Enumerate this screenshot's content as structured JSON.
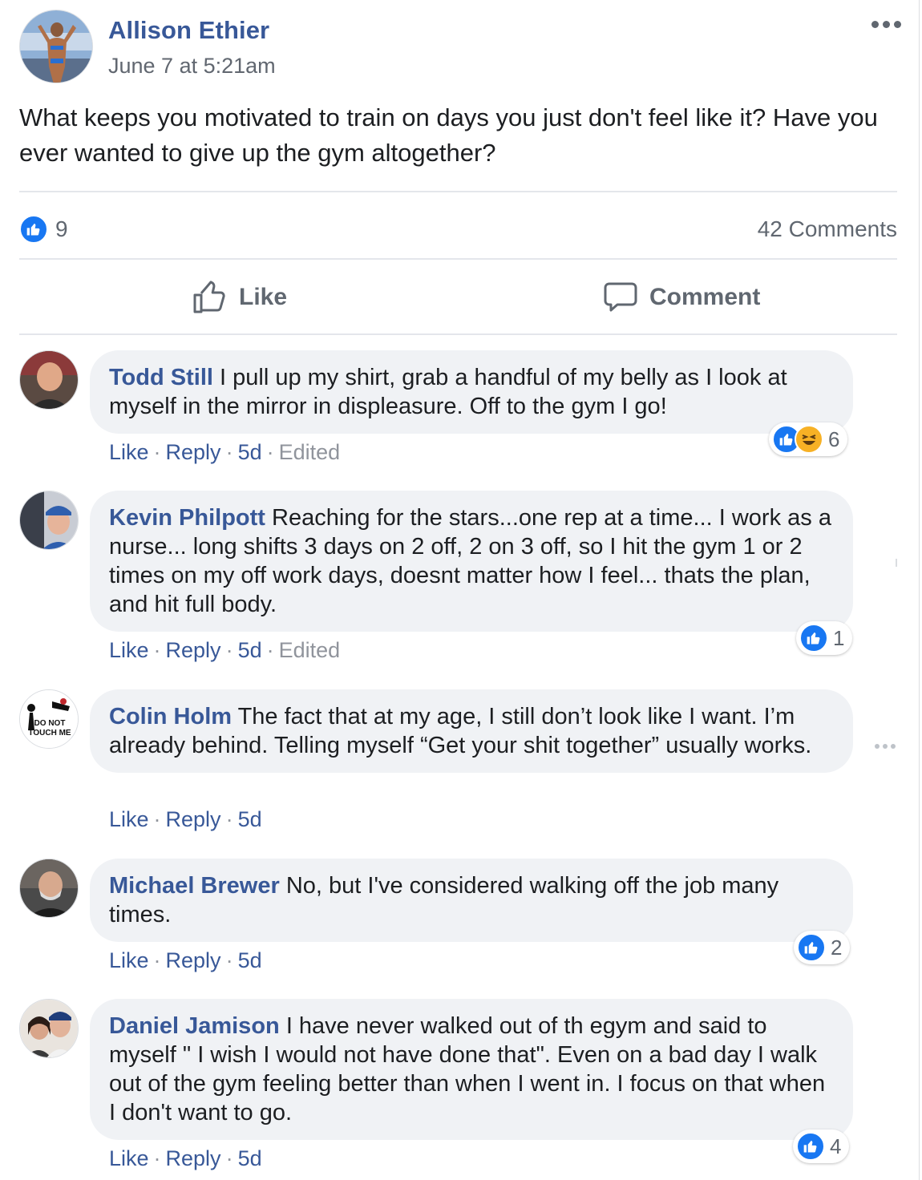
{
  "post": {
    "author": "Allison Ethier",
    "timestamp": "June 7 at 5:21am",
    "text": "What keeps you motivated to train on days you just don't feel like it? Have you ever wanted to give up the gym altogether?",
    "like_count": "9",
    "comments_count": "42 Comments",
    "actions": {
      "like": "Like",
      "comment": "Comment"
    }
  },
  "comments": [
    {
      "name": "Todd Still",
      "text": "I pull up my shirt, grab a handful of my belly as I look at myself in the mirror in displeasure. Off to the gym I go!",
      "like": "Like",
      "reply": "Reply",
      "time": "5d",
      "edited": "Edited",
      "reaction_count": "6",
      "reactions": [
        "like",
        "haha"
      ]
    },
    {
      "name": "Kevin Philpott",
      "text": "Reaching for the stars...one rep at a time... I work as a nurse... long shifts 3 days on 2 off, 2 on 3 off, so I hit the gym 1 or 2 times on my off work days, doesnt matter how I feel... thats the plan, and hit full body.",
      "like": "Like",
      "reply": "Reply",
      "time": "5d",
      "edited": "Edited",
      "reaction_count": "1",
      "reactions": [
        "like"
      ]
    },
    {
      "name": "Colin Holm",
      "text": "The fact that at my age, I still don’t look like I want. I’m already behind. Telling myself “Get your shit together” usually works.",
      "like": "Like",
      "reply": "Reply",
      "time": "5d"
    },
    {
      "name": "Michael Brewer",
      "text": "No, but I've considered walking off the job many times.",
      "like": "Like",
      "reply": "Reply",
      "time": "5d",
      "reaction_count": "2",
      "reactions": [
        "like"
      ]
    },
    {
      "name": "Daniel Jamison",
      "text": "I have never walked out of th egym and said to myself \" I wish I would not have done that\". Even on a bad day I walk out of the gym feeling better than when I went in. I focus on that when I don't want to go.",
      "like": "Like",
      "reply": "Reply",
      "time": "5d",
      "reaction_count": "4",
      "reactions": [
        "like"
      ]
    }
  ],
  "colors": {
    "link": "#385898",
    "like_blue": "#1877f2",
    "bubble": "#f0f2f5",
    "muted": "#606770",
    "meta_gray": "#90949c"
  },
  "icons": [
    "more-horizontal-icon",
    "like-thumb-icon",
    "comment-bubble-icon",
    "haha-reaction-icon"
  ]
}
